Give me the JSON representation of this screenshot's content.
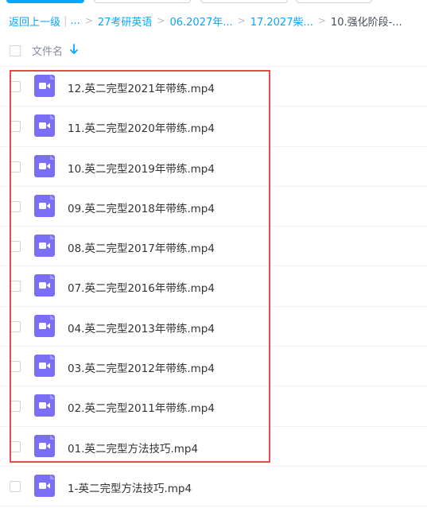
{
  "breadcrumb": {
    "back": "返回上一级",
    "ellipsis": "...",
    "items": [
      "27考研英语",
      "06.2027年...",
      "17.2027柴..."
    ],
    "current": "10.强化阶段-..."
  },
  "header": {
    "col_name": "文件名"
  },
  "files": [
    {
      "name": "12.英二完型2021年带练.mp4"
    },
    {
      "name": "11.英二完型2020年带练.mp4"
    },
    {
      "name": "10.英二完型2019年带练.mp4"
    },
    {
      "name": "09.英二完型2018年带练.mp4"
    },
    {
      "name": "08.英二完型2017年带练.mp4"
    },
    {
      "name": "07.英二完型2016年带练.mp4"
    },
    {
      "name": "04.英二完型2013年带练.mp4"
    },
    {
      "name": "03.英二完型2012年带练.mp4"
    },
    {
      "name": "02.英二完型2011年带练.mp4"
    },
    {
      "name": "01.英二完型方法技巧.mp4"
    },
    {
      "name": "1-英二完型方法技巧.mp4"
    }
  ],
  "icons": {
    "file_type": "video-file-icon",
    "sort": "sort-down-arrow-icon"
  },
  "colors": {
    "accent": "#06a7ff",
    "video_icon": "#7b6ef6",
    "highlight": "#e84a4a"
  }
}
